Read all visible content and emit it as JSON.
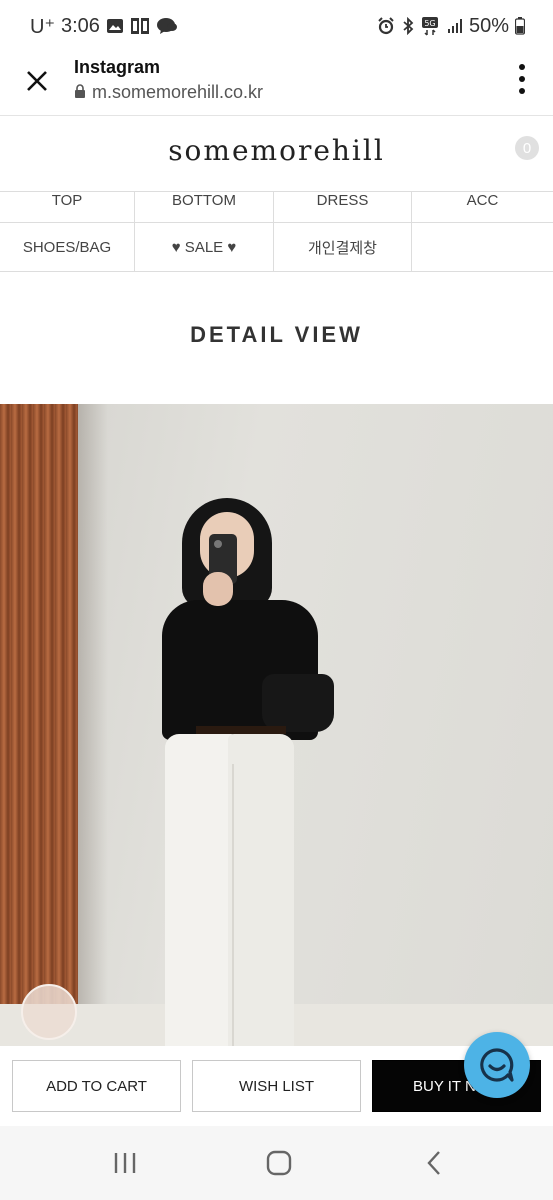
{
  "status_bar": {
    "carrier": "U⁺",
    "time": "3:06",
    "network": "5G",
    "battery": "50%"
  },
  "browser": {
    "app_name": "Instagram",
    "url": "m.somemorehill.co.kr"
  },
  "site": {
    "logo": "somemorehill",
    "cart_count": "0"
  },
  "categories": [
    {
      "label": "TOP"
    },
    {
      "label": "BOTTOM"
    },
    {
      "label": "DRESS"
    },
    {
      "label": "ACC"
    },
    {
      "label": "SHOES/BAG"
    },
    {
      "label": "♥ SALE ♥"
    },
    {
      "label": "개인결제창"
    },
    {
      "label": ""
    }
  ],
  "page": {
    "title": "DETAIL VIEW"
  },
  "actions": {
    "add_to_cart": "ADD TO CART",
    "wish_list": "WISH LIST",
    "buy_it_now": "BUY IT N"
  },
  "icons": {
    "close": "close-icon",
    "lock": "lock-icon",
    "menu": "more-vert-icon",
    "chat": "chat-icon",
    "recents": "recents-icon",
    "home": "home-icon",
    "back": "back-icon"
  },
  "colors": {
    "accent_chat": "#4db3e6",
    "buy_button": "#050505"
  }
}
